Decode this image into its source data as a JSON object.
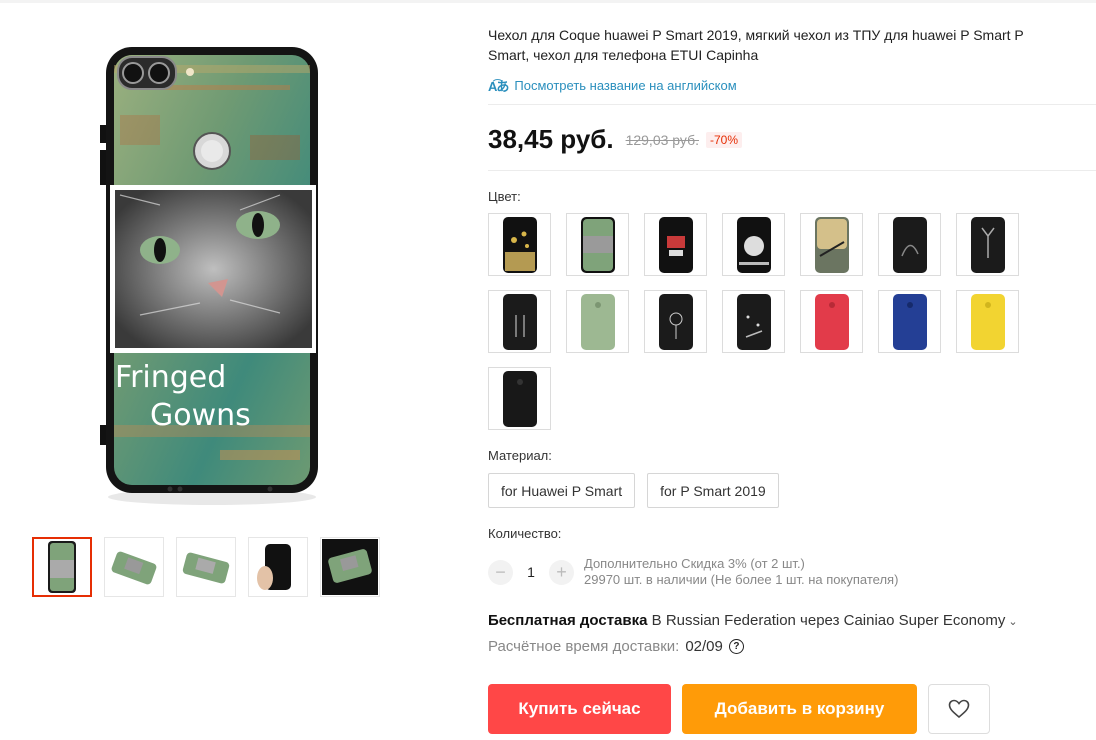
{
  "product": {
    "title_line1": "Чехол для Coque huawei P Smart 2019, мягкий чехол из ТПУ для huawei P Smart P",
    "title_line2": "Smart, чехол для телефона ETUI Capinha",
    "translate_link": "Посмотреть название на английском",
    "translate_icon": "translate-icon"
  },
  "price": {
    "current": "38,45 руб.",
    "old": "129,03 руб.",
    "discount": "-70%"
  },
  "image": {
    "print_text_1": "Fringed",
    "print_text_2": "Gowns"
  },
  "color": {
    "label": "Цвет:",
    "swatches": [
      "gold-butterflies",
      "cat-green",
      "black-red-print",
      "moon",
      "bird-sunset",
      "black-pattern",
      "deer-black",
      "black-couple",
      "sage-green",
      "black-dandelion",
      "black-stars",
      "red",
      "navy-blue",
      "yellow",
      "black-plain"
    ]
  },
  "material": {
    "label": "Материал:",
    "options": [
      "for Huawei P Smart",
      "for P Smart 2019"
    ]
  },
  "quantity": {
    "label": "Количество:",
    "value": "1",
    "minus": "−",
    "plus": "+",
    "discount_note": "Дополнительно Скидка 3% (от 2 шт.)",
    "stock_note": "29970 шт. в наличии (Не более 1 шт. на покупателя)"
  },
  "shipping": {
    "free": "Бесплатная доставка",
    "route": "В Russian Federation через Cainiao Super Economy",
    "chevron": "›",
    "eta_label": "Расчётное время доставки:",
    "eta_date": "02/09",
    "help": "?"
  },
  "actions": {
    "buy": "Купить сейчас",
    "cart": "Добавить в корзину"
  },
  "colors": {
    "accent_red": "#ff4747",
    "accent_orange": "#ff9b08",
    "link_blue": "#2a8fbd",
    "discount_red": "#e62e04"
  }
}
